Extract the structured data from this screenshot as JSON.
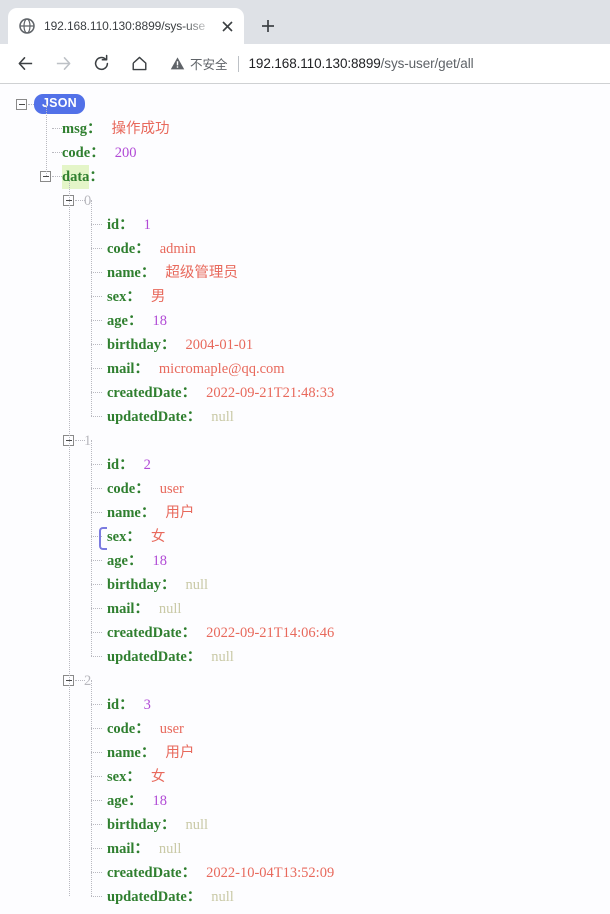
{
  "browser": {
    "tab": {
      "title": "192.168.110.130:8899/sys-use",
      "favicon_icon": "globe-icon",
      "close_icon": "close-icon"
    },
    "newtab_icon": "plus-icon",
    "nav": {
      "back_icon": "back-arrow-icon",
      "forward_icon": "forward-arrow-icon",
      "reload_icon": "reload-icon",
      "home_icon": "home-icon"
    },
    "omnibox": {
      "warning_icon": "warning-triangle-icon",
      "security_text": "不安全",
      "url_host": "192.168.110.130:8899",
      "url_path": "/sys-user/get/all"
    }
  },
  "viewer": {
    "root_label": "JSON",
    "rows": [
      {
        "key": "msg",
        "colon": "：",
        "value": "操作成功",
        "type": "str"
      },
      {
        "key": "code",
        "colon": "：",
        "value": "200",
        "type": "num"
      },
      {
        "key": "data",
        "colon": "：",
        "value": "",
        "type": "node"
      }
    ],
    "records": [
      {
        "index": "0",
        "fields": [
          {
            "key": "id",
            "colon": "：",
            "value": "1",
            "type": "num"
          },
          {
            "key": "code",
            "colon": "：",
            "value": "admin",
            "type": "str"
          },
          {
            "key": "name",
            "colon": "：",
            "value": "超级管理员",
            "type": "str"
          },
          {
            "key": "sex",
            "colon": "：",
            "value": "男",
            "type": "str"
          },
          {
            "key": "age",
            "colon": "：",
            "value": "18",
            "type": "num"
          },
          {
            "key": "birthday",
            "colon": "：",
            "value": "2004-01-01",
            "type": "str"
          },
          {
            "key": "mail",
            "colon": "：",
            "value": "micromaple@qq.com",
            "type": "str"
          },
          {
            "key": "createdDate",
            "colon": "：",
            "value": "2022-09-21T21:48:33",
            "type": "str"
          },
          {
            "key": "updatedDate",
            "colon": "：",
            "value": "null",
            "type": "null"
          }
        ]
      },
      {
        "index": "1",
        "fields": [
          {
            "key": "id",
            "colon": "：",
            "value": "2",
            "type": "num"
          },
          {
            "key": "code",
            "colon": "：",
            "value": "user",
            "type": "str"
          },
          {
            "key": "name",
            "colon": "：",
            "value": "用户",
            "type": "str"
          },
          {
            "key": "sex",
            "colon": "：",
            "value": "女",
            "type": "str"
          },
          {
            "key": "age",
            "colon": "：",
            "value": "18",
            "type": "num"
          },
          {
            "key": "birthday",
            "colon": "：",
            "value": "null",
            "type": "null"
          },
          {
            "key": "mail",
            "colon": "：",
            "value": "null",
            "type": "null"
          },
          {
            "key": "createdDate",
            "colon": "：",
            "value": "2022-09-21T14:06:46",
            "type": "str"
          },
          {
            "key": "updatedDate",
            "colon": "：",
            "value": "null",
            "type": "null"
          }
        ]
      },
      {
        "index": "2",
        "fields": [
          {
            "key": "id",
            "colon": "：",
            "value": "3",
            "type": "num"
          },
          {
            "key": "code",
            "colon": "：",
            "value": "user",
            "type": "str"
          },
          {
            "key": "name",
            "colon": "：",
            "value": "用户",
            "type": "str"
          },
          {
            "key": "sex",
            "colon": "：",
            "value": "女",
            "type": "str"
          },
          {
            "key": "age",
            "colon": "：",
            "value": "18",
            "type": "num"
          },
          {
            "key": "birthday",
            "colon": "：",
            "value": "null",
            "type": "null"
          },
          {
            "key": "mail",
            "colon": "：",
            "value": "null",
            "type": "null"
          },
          {
            "key": "createdDate",
            "colon": "：",
            "value": "2022-10-04T13:52:09",
            "type": "str"
          },
          {
            "key": "updatedDate",
            "colon": "：",
            "value": "null",
            "type": "null"
          }
        ]
      }
    ]
  },
  "colors": {
    "key": "#2f7f2f",
    "string": "#e8695c",
    "number": "#b14ad6",
    "null": "#c9c9a6",
    "badge": "#5271e8",
    "highlight": "#e4f5c8"
  }
}
